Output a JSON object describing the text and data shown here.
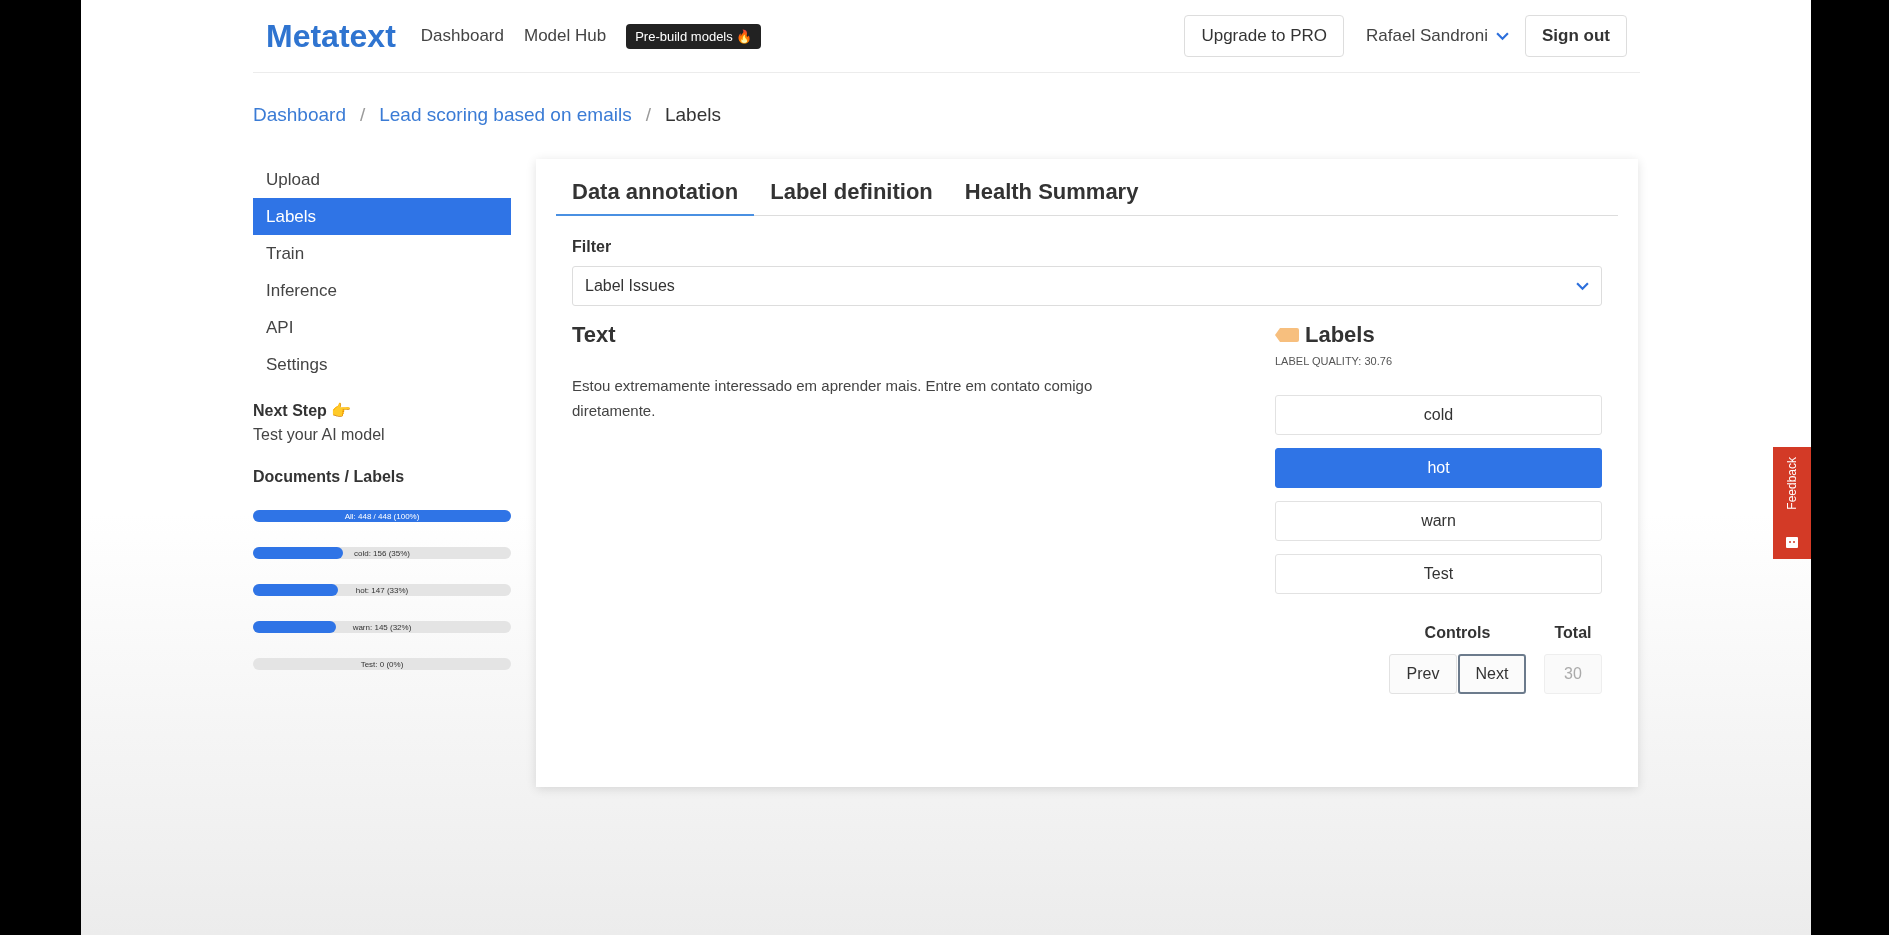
{
  "header": {
    "logo": "Metatext",
    "nav": [
      {
        "label": "Dashboard"
      },
      {
        "label": "Model Hub"
      }
    ],
    "badge": "Pre-build models 🔥",
    "upgrade_button": "Upgrade to PRO",
    "user": "Rafael Sandroni",
    "sign_out_button": "Sign out"
  },
  "breadcrumb": [
    {
      "label": "Dashboard",
      "link": true
    },
    {
      "separator": "/",
      "label": "Lead scoring based on emails",
      "link": true
    },
    {
      "separator": "/",
      "label": "Labels",
      "link": false
    }
  ],
  "sidebar": {
    "items": [
      {
        "label": "Upload",
        "selected": false
      },
      {
        "label": "Labels",
        "selected": true
      },
      {
        "label": "Train",
        "selected": false
      },
      {
        "label": "Inference",
        "selected": false
      },
      {
        "label": "API",
        "selected": false
      },
      {
        "label": "Settings",
        "selected": false
      }
    ],
    "next_step_title": "Next Step 👉",
    "next_step_text": "Test your AI model",
    "documents_title": "Documents / Labels",
    "bars": [
      {
        "text": "All: 448 / 448 (100%)",
        "level": 1
      },
      {
        "text": "cold: 156 (35%)",
        "level": 0.35
      },
      {
        "text": "hot: 147 (33%)",
        "level": 0.33
      },
      {
        "text": "warn: 145 (32%)",
        "level": 0.32
      },
      {
        "text": "Test: 0 (0%)",
        "level": 0
      }
    ]
  },
  "tabs": [
    {
      "label": "Data annotation",
      "selected": true
    },
    {
      "label": "Label definition",
      "selected": false
    },
    {
      "label": "Health Summary",
      "selected": false
    }
  ],
  "filter": {
    "label": "Filter",
    "value": "Label Issues"
  },
  "text_section": {
    "title": "Text",
    "body": "Estou extremamente interessado em aprender mais. Entre em contato comigo diretamente."
  },
  "labels_section": {
    "title": "Labels",
    "quality": "LABEL QUALITY: 30.76",
    "labels": [
      {
        "label": "cold",
        "selected": false
      },
      {
        "label": "hot",
        "selected": true
      },
      {
        "label": "warn",
        "selected": false
      },
      {
        "label": "Test",
        "selected": false
      }
    ]
  },
  "controls": {
    "title": "Controls",
    "prev": "Prev",
    "next": "Next",
    "total_title": "Total",
    "total_value": "30"
  },
  "feedback": "Feedback"
}
